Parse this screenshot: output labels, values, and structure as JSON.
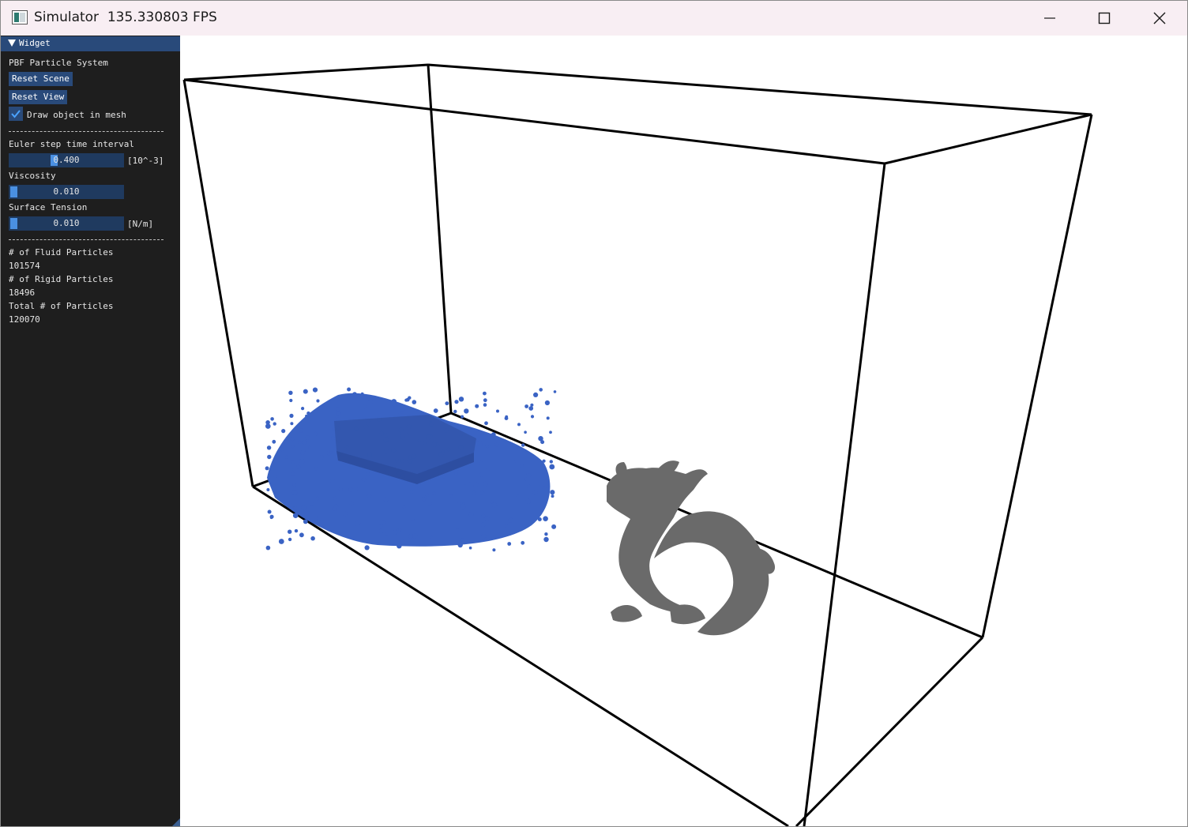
{
  "window": {
    "title": "Simulator  135.330803 FPS",
    "controls": [
      "minimize",
      "maximize",
      "close"
    ]
  },
  "panel": {
    "header": "Widget",
    "system_label": "PBF Particle System",
    "reset_scene_label": "Reset Scene",
    "reset_view_label": "Reset View",
    "draw_mesh_label": "Draw object in mesh",
    "draw_mesh_checked": true,
    "separator": "----------------------------",
    "euler_label": "Euler step time interval",
    "euler_value": "0.400",
    "euler_unit": "[10^-3]",
    "euler_fraction": 0.38,
    "viscosity_label": "Viscosity",
    "viscosity_value": "0.010",
    "viscosity_fraction": 0.0,
    "tension_label": "Surface Tension",
    "tension_value": "0.010",
    "tension_unit": "[N/m]",
    "tension_fraction": 0.0,
    "fluid_label": "# of Fluid Particles",
    "fluid_count": "101574",
    "rigid_label": "# of Rigid Particles",
    "rigid_count": "18496",
    "total_label": "Total # of Particles",
    "total_count": "120070"
  },
  "scene": {
    "fluid_color": "#3a63c4",
    "mesh_color": "#6a6a6a",
    "box_color": "#000000"
  }
}
